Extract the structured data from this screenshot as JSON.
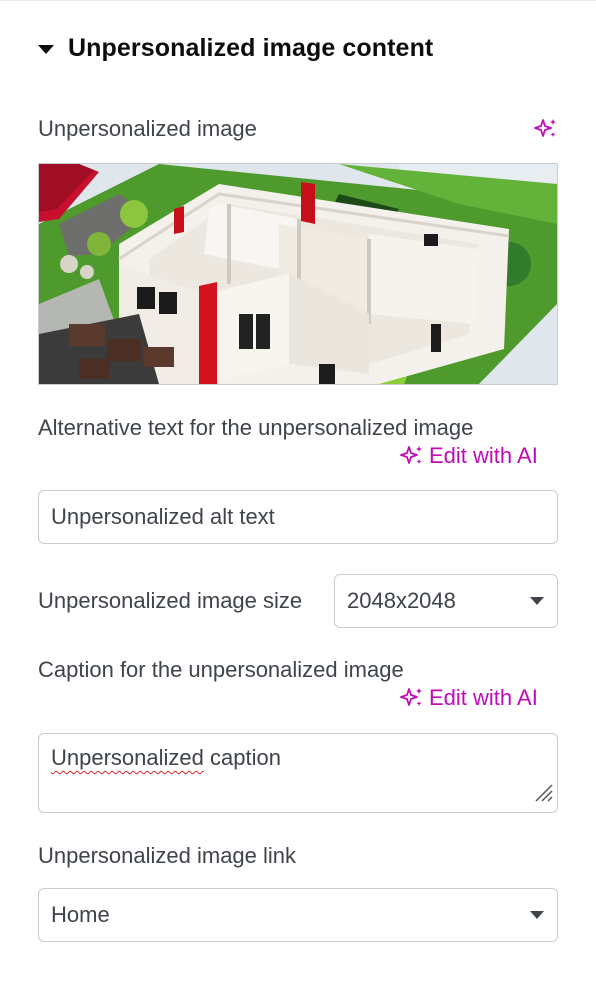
{
  "section": {
    "title": "Unpersonalized image content"
  },
  "image_field": {
    "label": "Unpersonalized image",
    "ai_icon": "sparkle-icon",
    "image_description": "architectural house model"
  },
  "alt_text_field": {
    "label": "Alternative text for the unpersonalized image",
    "ai_link_label": "Edit with AI",
    "value": "Unpersonalized alt text"
  },
  "size_field": {
    "label": "Unpersonalized image size",
    "selected": "2048x2048"
  },
  "caption_field": {
    "label": "Caption for the unpersonalized image",
    "ai_link_label": "Edit with AI",
    "value_misspelled": "Unpersonalized",
    "value_rest": " caption"
  },
  "link_field": {
    "label": "Unpersonalized image link",
    "selected": "Home"
  },
  "colors": {
    "accent": "#c00bb9",
    "text": "#3f444b",
    "heading": "#0c0d0e",
    "border": "#c9ccd0"
  }
}
